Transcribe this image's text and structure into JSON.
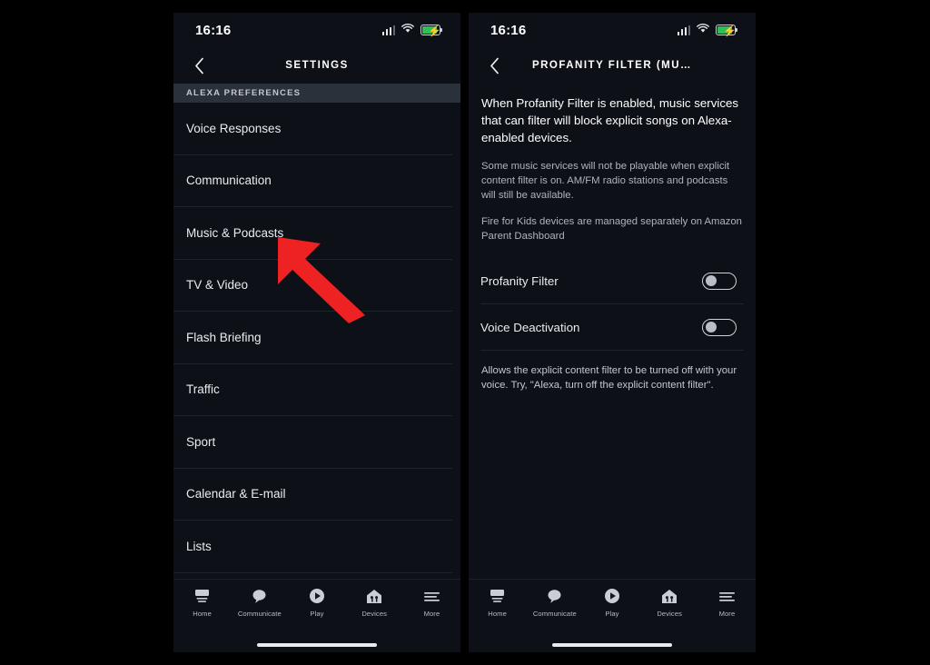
{
  "status_bar": {
    "time": "16:16",
    "icons": [
      "signal-icon",
      "wifi-icon",
      "battery-charging-icon"
    ]
  },
  "left_phone": {
    "nav": {
      "back_icon": "chevron-left-icon",
      "title": "SETTINGS"
    },
    "section_header": "ALEXA PREFERENCES",
    "items": [
      {
        "label": "Voice Responses"
      },
      {
        "label": "Communication"
      },
      {
        "label": "Music & Podcasts"
      },
      {
        "label": "TV & Video"
      },
      {
        "label": "Flash Briefing"
      },
      {
        "label": "Traffic"
      },
      {
        "label": "Sport"
      },
      {
        "label": "Calendar & E-mail"
      },
      {
        "label": "Lists"
      }
    ]
  },
  "right_phone": {
    "nav": {
      "back_icon": "chevron-left-icon",
      "title": "PROFANITY FILTER (MU…"
    },
    "lead_paragraph": "When Profanity Filter is enabled, music services that can filter will block explicit songs on Alexa-enabled devices.",
    "note_1": "Some music services will not be playable when explicit content filter is on. AM/FM radio stations and podcasts will still be available.",
    "note_2": "Fire for Kids devices are managed separately on Amazon Parent Dashboard",
    "toggles": [
      {
        "label": "Profanity Filter",
        "state": "off"
      },
      {
        "label": "Voice Deactivation",
        "state": "off"
      }
    ],
    "footer_note": "Allows the explicit content filter to be turned off with your voice. Try, \"Alexa, turn off the explicit content filter\"."
  },
  "tab_bar": {
    "tabs": [
      {
        "label": "Home",
        "icon": "echo-device-icon"
      },
      {
        "label": "Communicate",
        "icon": "speech-bubble-icon"
      },
      {
        "label": "Play",
        "icon": "play-circle-icon"
      },
      {
        "label": "Devices",
        "icon": "home-devices-icon"
      },
      {
        "label": "More",
        "icon": "hamburger-menu-icon"
      }
    ]
  },
  "annotation": {
    "arrow_color": "#ee2222",
    "points_at": "Music & Podcasts"
  },
  "colors": {
    "page_background": "#000000",
    "phone_background": "#0d1117",
    "section_band": "#2b313a",
    "divider": "#1d242d",
    "primary_text": "#ffffff",
    "secondary_text": "#aeb4bd",
    "battery_green": "#2fbf57",
    "arrow_red": "#ee2222"
  }
}
